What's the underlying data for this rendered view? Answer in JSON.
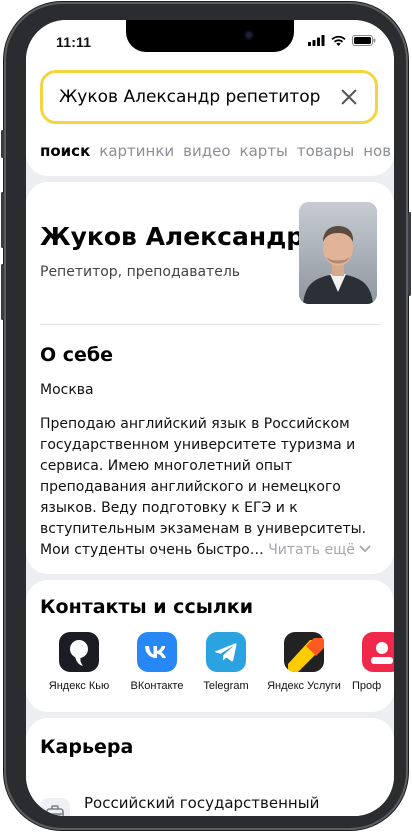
{
  "status_bar": {
    "time": "11:11"
  },
  "search": {
    "query": "Жуков Александр репетитор"
  },
  "tabs": [
    "поиск",
    "картинки",
    "видео",
    "карты",
    "товары",
    "нов"
  ],
  "profile": {
    "name": "Жуков Александр",
    "role": "Репетитор, преподаватель"
  },
  "about": {
    "title": "О себе",
    "city": "Москва",
    "text": "Преподаю английский язык в Российском государственном университете туризма и сервиса. Имею многолетний опыт преподавания английского и немецкого языков. Веду подготовку к ЕГЭ и к вступительным экзаменам в университеты. Мои студенты очень быстро…",
    "read_more": "Читать ещё"
  },
  "contacts": {
    "title": "Контакты и ссылки",
    "items": [
      {
        "label": "Яндекс Кью",
        "icon": "yandex-q-icon",
        "color": "#1c1c24"
      },
      {
        "label": "ВКонтакте",
        "icon": "vk-icon",
        "color": "#2787f5"
      },
      {
        "label": "Telegram",
        "icon": "telegram-icon",
        "color": "#2aa3e0"
      },
      {
        "label": "Яндекс Услуги",
        "icon": "yandex-services-icon",
        "color": "#222222"
      },
      {
        "label": "Проф",
        "icon": "profile-icon",
        "color": "#f0284a"
      }
    ]
  },
  "career": {
    "title": "Карьера",
    "item": "Российский государственный университет туризма и сервиса"
  },
  "colors": {
    "search_border": "#f5d442",
    "muted_text": "#8c8f95"
  }
}
